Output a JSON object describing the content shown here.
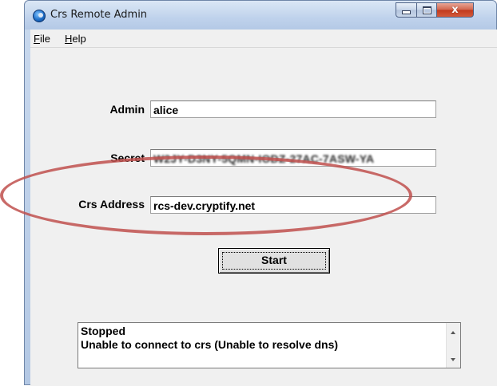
{
  "window": {
    "title": "Crs Remote Admin",
    "close_glyph": "x"
  },
  "menu": {
    "file": {
      "accel": "F",
      "rest": "ile"
    },
    "help": {
      "accel": "H",
      "rest": "elp"
    }
  },
  "form": {
    "admin_label": "Admin",
    "admin_value": "alice",
    "secret_label": "Secret",
    "secret_value": "W2JY-D3NY-5QMN-IODZ-27AC-7ASW-YA",
    "address_label": "Crs Address",
    "address_value": "rcs-dev.cryptify.net"
  },
  "actions": {
    "start_label": "Start"
  },
  "status": {
    "line1": "Stopped",
    "line2": "Unable to connect to crs (Unable to resolve dns)"
  },
  "icons": {
    "app": "crs-app-icon",
    "minimize": "minimize-icon",
    "maximize": "maximize-icon",
    "close": "close-icon"
  },
  "colors": {
    "annotation": "#c0504d",
    "close_button": "#c1391c"
  }
}
